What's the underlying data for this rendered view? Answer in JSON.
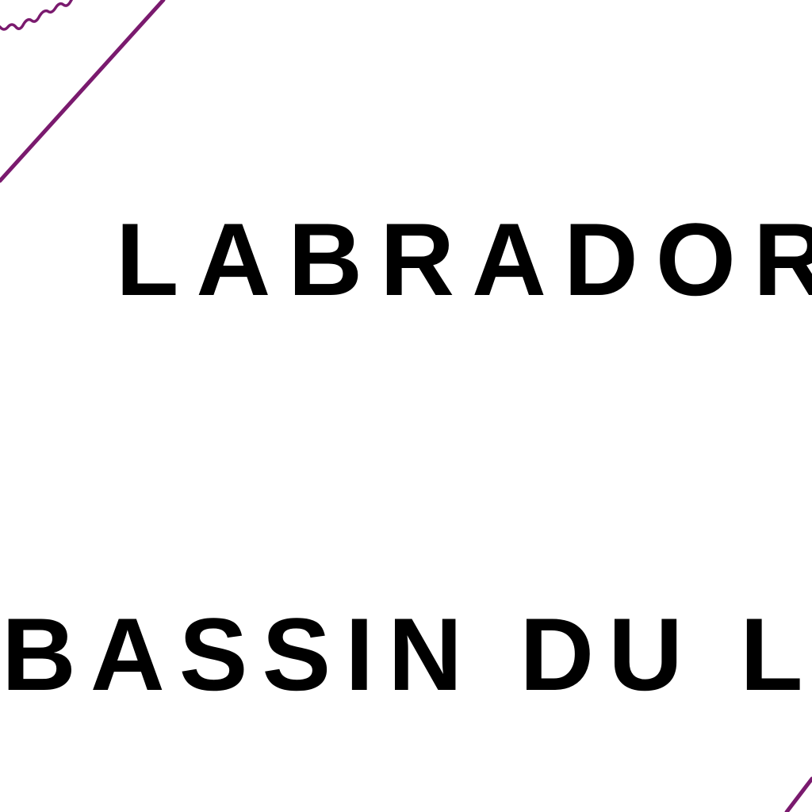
{
  "map": {
    "labels": {
      "english_name": "LABRADOR BASIN",
      "french_name": "BASSIN DU LABRADOR"
    },
    "colors": {
      "boundary_line": "#7a1a6e",
      "label_text": "#000000",
      "background": "#ffffff"
    }
  }
}
